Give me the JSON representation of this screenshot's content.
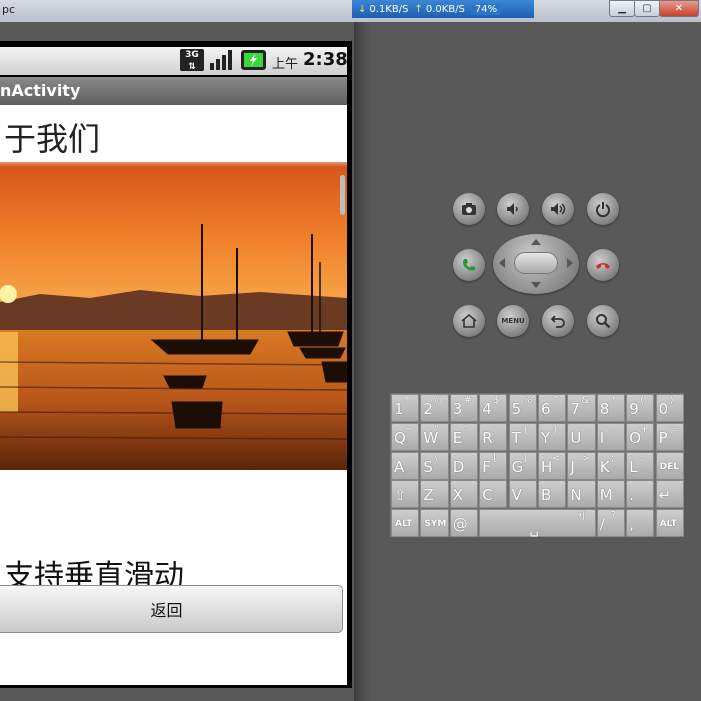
{
  "host_window": {
    "title_fragment": "pc",
    "net_meter": {
      "down": "0.1KB/S",
      "up": "0.0KB/S",
      "battery": "74%"
    }
  },
  "status_bar": {
    "network": "3G",
    "ampm": "上午",
    "time": "2:38"
  },
  "app": {
    "title": "nActivity",
    "heading": "于我们",
    "subtext": "支持垂直滑动",
    "back_button": "返回"
  },
  "emulator_controls": {
    "menu_label": "MENU"
  },
  "keyboard": {
    "rows": [
      [
        {
          "m": "1",
          "s": "!"
        },
        {
          "m": "2",
          "s": "@"
        },
        {
          "m": "3",
          "s": "#"
        },
        {
          "m": "4",
          "s": "$"
        },
        {
          "m": "5",
          "s": "%"
        },
        {
          "m": "6",
          "s": "^"
        },
        {
          "m": "7",
          "s": "&"
        },
        {
          "m": "8",
          "s": "*"
        },
        {
          "m": "9",
          "s": "("
        },
        {
          "m": "0",
          "s": ")"
        }
      ],
      [
        {
          "m": "Q",
          "s": "~"
        },
        {
          "m": "W",
          "s": "\""
        },
        {
          "m": "E",
          "s": "\""
        },
        {
          "m": "R",
          "s": "`"
        },
        {
          "m": "T",
          "s": "{"
        },
        {
          "m": "Y",
          "s": "}"
        },
        {
          "m": "U",
          "s": "-"
        },
        {
          "m": "I",
          "s": "-"
        },
        {
          "m": "O",
          "s": "+"
        },
        {
          "m": "P",
          "s": "="
        }
      ],
      [
        {
          "m": "A",
          "s": ""
        },
        {
          "m": "S",
          "s": "\\"
        },
        {
          "m": "D",
          "s": "'"
        },
        {
          "m": "F",
          "s": "["
        },
        {
          "m": "G",
          "s": "]"
        },
        {
          "m": "H",
          "s": "<"
        },
        {
          "m": "J",
          "s": ">"
        },
        {
          "m": "K",
          "s": ";"
        },
        {
          "m": "L",
          "s": ":"
        },
        {
          "m": "DEL",
          "s": ""
        }
      ],
      [
        {
          "m": "⇧",
          "s": ""
        },
        {
          "m": "Z",
          "s": ""
        },
        {
          "m": "X",
          "s": ""
        },
        {
          "m": "C",
          "s": ""
        },
        {
          "m": "V",
          "s": ""
        },
        {
          "m": "B",
          "s": ""
        },
        {
          "m": "N",
          "s": ""
        },
        {
          "m": "M",
          "s": ""
        },
        {
          "m": ".",
          "s": ""
        },
        {
          "m": "↵",
          "s": ""
        }
      ],
      [
        {
          "m": "ALT",
          "s": ""
        },
        {
          "m": "SYM",
          "s": ""
        },
        {
          "m": "@",
          "s": ""
        },
        {
          "m": "␣",
          "s": "→|"
        },
        {
          "m": "/",
          "s": "?"
        },
        {
          "m": ",",
          "s": ""
        },
        {
          "m": "ALT",
          "s": ""
        }
      ]
    ]
  }
}
